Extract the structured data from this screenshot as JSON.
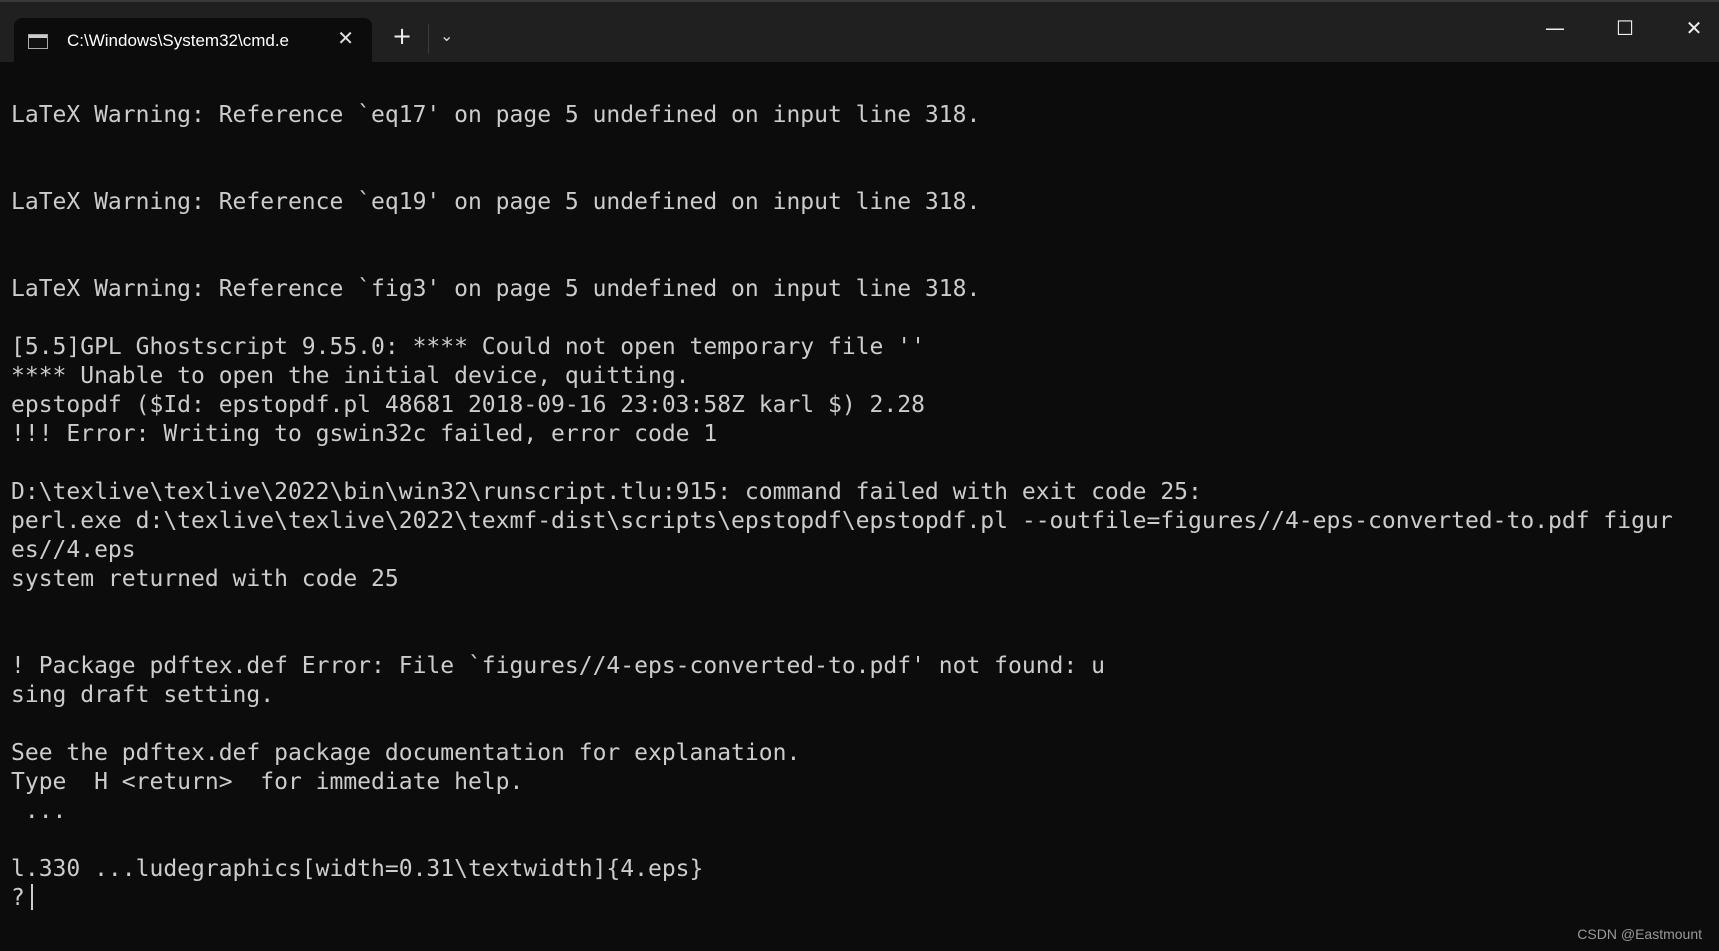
{
  "window": {
    "tab_title": "C:\\Windows\\System32\\cmd.e",
    "icons": {
      "tab": "terminal-icon",
      "close": "close-icon",
      "new_tab": "plus-icon",
      "dropdown": "chevron-down-icon",
      "minimize": "minimize-icon",
      "maximize": "maximize-icon",
      "window_close": "close-icon"
    }
  },
  "terminal": {
    "lines": [
      "LaTeX Warning: Reference `eq17' on page 5 undefined on input line 318.",
      "",
      "",
      "LaTeX Warning: Reference `eq19' on page 5 undefined on input line 318.",
      "",
      "",
      "LaTeX Warning: Reference `fig3' on page 5 undefined on input line 318.",
      "",
      "[5.5]GPL Ghostscript 9.55.0: **** Could not open temporary file ''",
      "**** Unable to open the initial device, quitting.",
      "epstopdf ($Id: epstopdf.pl 48681 2018-09-16 23:03:58Z karl $) 2.28",
      "!!! Error: Writing to gswin32c failed, error code 1",
      "",
      "D:\\texlive\\texlive\\2022\\bin\\win32\\runscript.tlu:915: command failed with exit code 25:",
      "perl.exe d:\\texlive\\texlive\\2022\\texmf-dist\\scripts\\epstopdf\\epstopdf.pl --outfile=figures//4-eps-converted-to.pdf figur",
      "es//4.eps",
      "system returned with code 25",
      "",
      "",
      "! Package pdftex.def Error: File `figures//4-eps-converted-to.pdf' not found: u",
      "sing draft setting.",
      "",
      "See the pdftex.def package documentation for explanation.",
      "Type  H <return>  for immediate help.",
      " ...",
      "",
      "l.330 ...ludegraphics[width=0.31\\textwidth]{4.eps}",
      ""
    ],
    "prompt": "?"
  },
  "watermark": "CSDN @Eastmount"
}
